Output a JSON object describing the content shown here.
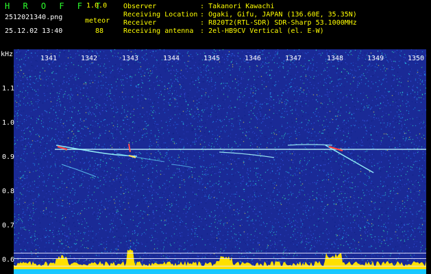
{
  "header": {
    "app_name": "H R O F F T",
    "version": "1.0.0",
    "filename": "2512021340.png",
    "type_label": "meteor",
    "timestamp": "25.12.02 13:40",
    "count": "88"
  },
  "info": {
    "observer_label": "Observer",
    "observer_value": "Takanori Kawachi",
    "location_label": "Receiving Location",
    "location_value": "Ogaki, Gifu, JAPAN (136.60E, 35.35N)",
    "receiver_label": "Receiver",
    "receiver_value": "R820T2(RTL-SDR) SDR-Sharp 53.1000MHz",
    "antenna_label": "Receiving antenna",
    "antenna_value": "2el-HB9CV Vertical (el. E-W)",
    "separator": ":"
  },
  "axes": {
    "y_unit": "kHz",
    "y_ticks": [
      "1.1",
      "1.0",
      "0.9",
      "0.8",
      "0.7",
      "0.6"
    ],
    "x_ticks": [
      "1341",
      "1342",
      "1343",
      "1344",
      "1345",
      "1346",
      "1347",
      "1348",
      "1349",
      "1350"
    ]
  },
  "colors": {
    "background": "#1a2a96",
    "carrier": "#c8ffff",
    "meteor_red": "#ff3030",
    "spectrum": "#ffe000",
    "baseline": "#18c8ff"
  }
}
